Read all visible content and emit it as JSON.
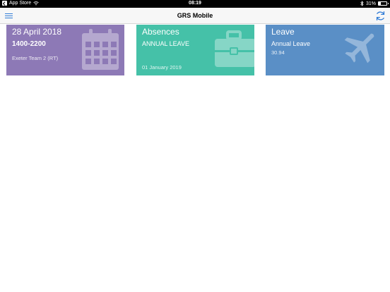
{
  "status_bar": {
    "back_app": "App Store",
    "time": "08:19",
    "battery": "31%",
    "battery_level": 0.31
  },
  "nav": {
    "title": "GRS Mobile",
    "left_icon": "menu-icon",
    "right_icon": "sync-icon",
    "accent": "#2f7bd6"
  },
  "tiles": [
    {
      "heading": "28 April 2018",
      "sub": "1400-2200",
      "foot": "Exeter Team 2 (RT)",
      "icon": "calendar-icon",
      "color": "#8d79b6"
    },
    {
      "heading": "Absences",
      "sub": "ANNUAL LEAVE",
      "foot": "01 January 2019",
      "icon": "briefcase-icon",
      "color": "#45c1a8"
    },
    {
      "heading": "Leave",
      "sub": "Annual Leave",
      "foot": "30.94",
      "icon": "airplane-icon",
      "color": "#5a8fc6"
    }
  ]
}
